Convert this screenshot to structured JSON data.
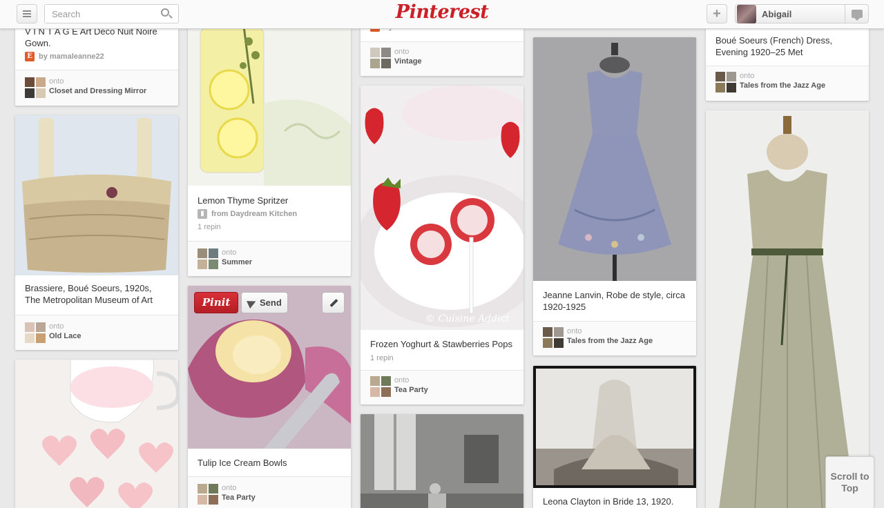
{
  "header": {
    "search_placeholder": "Search",
    "logo_text": "Pinterest",
    "user_name": "Abigail"
  },
  "pins": {
    "vintage_gown": {
      "description": "V I N T A G E Art Deco Nuit Noire Gown.",
      "source": "by mamaleanne22",
      "onto": "onto",
      "board": "Closet and Dressing Mirror"
    },
    "brassiere": {
      "description": "Brassiere, Boué Soeurs, 1920s, The Metropolitan Museum of Art",
      "onto": "onto",
      "board": "Old Lace"
    },
    "lemon": {
      "description": "Lemon Thyme Spritzer",
      "source": "from Daydream Kitchen",
      "stats": "1 repin",
      "onto": "onto",
      "board": "Summer"
    },
    "tulip": {
      "pinit_label": "Pinit",
      "send_label": "Send",
      "description": "Tulip Ice Cream Bowls",
      "onto": "onto",
      "board": "Tea Party"
    },
    "vintage_top": {
      "source_partial": "by Peuane",
      "onto": "onto",
      "board": "Vintage"
    },
    "strawberry": {
      "watermark": "© Cuisine Addict",
      "description": "Frozen Yoghurt & Stawberries Pops",
      "stats": "1 repin",
      "onto": "onto",
      "board": "Tea Party"
    },
    "lanvin": {
      "description": "Jeanne Lanvin, Robe de style, circa 1920-1925",
      "onto": "onto",
      "board": "Tales from the Jazz Age"
    },
    "leona": {
      "description": "Leona Clayton in Bride 13, 1920."
    },
    "boue_dress": {
      "description": "Boué Soeurs (French) Dress, Evening 1920–25 Met",
      "onto": "onto",
      "board": "Tales from the Jazz Age"
    }
  },
  "scroll_to_top": "Scroll to Top",
  "colors": {
    "brand": "#cb2027",
    "background": "#e9e9e9",
    "card": "#ffffff"
  }
}
